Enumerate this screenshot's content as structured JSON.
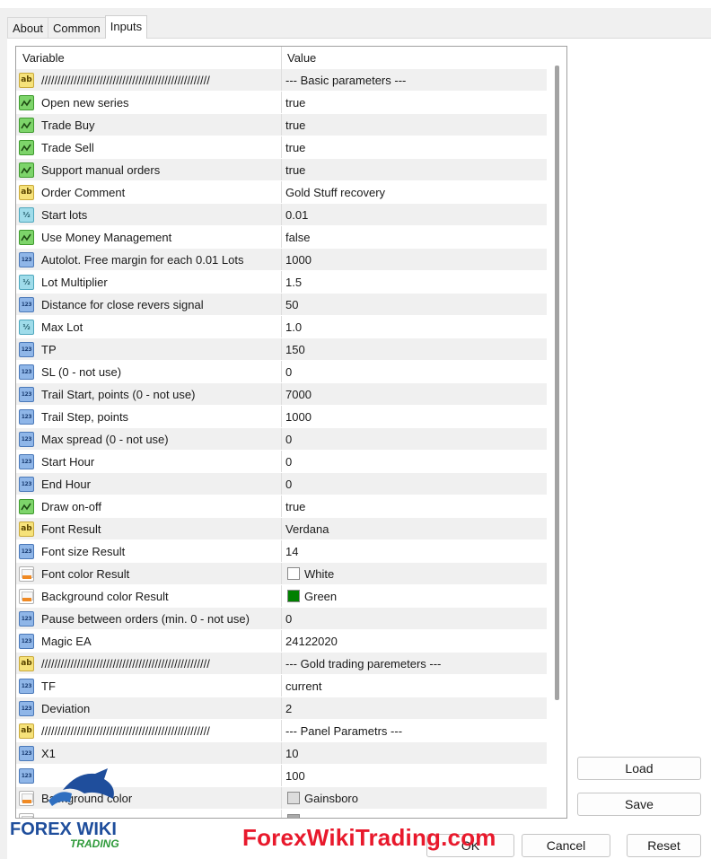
{
  "tabs": [
    {
      "label": "About",
      "active": false
    },
    {
      "label": "Common",
      "active": false
    },
    {
      "label": "Inputs",
      "active": true
    }
  ],
  "grid": {
    "headers": {
      "variable": "Variable",
      "value": "Value"
    },
    "rows": [
      {
        "type": "string",
        "icon": "string-type-icon",
        "variable": "////////////////////////////////////////////////////",
        "value": "--- Basic parameters ---"
      },
      {
        "type": "bool",
        "icon": "bool-type-icon",
        "variable": "Open new series",
        "value": "true"
      },
      {
        "type": "bool",
        "icon": "bool-type-icon",
        "variable": "Trade Buy",
        "value": "true"
      },
      {
        "type": "bool",
        "icon": "bool-type-icon",
        "variable": "Trade Sell",
        "value": "true"
      },
      {
        "type": "bool",
        "icon": "bool-type-icon",
        "variable": "Support manual orders",
        "value": "true"
      },
      {
        "type": "string",
        "icon": "string-type-icon",
        "variable": "Order Comment",
        "value": "Gold Stuff recovery"
      },
      {
        "type": "double",
        "icon": "double-type-icon",
        "variable": "Start lots",
        "value": "0.01"
      },
      {
        "type": "bool",
        "icon": "bool-type-icon",
        "variable": "Use Money Management",
        "value": "false"
      },
      {
        "type": "int",
        "icon": "int-type-icon",
        "variable": "Autolot. Free margin for each 0.01 Lots",
        "value": "1000"
      },
      {
        "type": "double",
        "icon": "double-type-icon",
        "variable": "Lot Multiplier",
        "value": "1.5"
      },
      {
        "type": "int",
        "icon": "int-type-icon",
        "variable": "Distance for close revers signal",
        "value": "50"
      },
      {
        "type": "double",
        "icon": "double-type-icon",
        "variable": "Max Lot",
        "value": "1.0"
      },
      {
        "type": "int",
        "icon": "int-type-icon",
        "variable": "TP",
        "value": "150"
      },
      {
        "type": "int",
        "icon": "int-type-icon",
        "variable": "SL (0 - not use)",
        "value": "0"
      },
      {
        "type": "int",
        "icon": "int-type-icon",
        "variable": "Trail Start, points (0 - not use)",
        "value": "7000"
      },
      {
        "type": "int",
        "icon": "int-type-icon",
        "variable": "Trail Step, points",
        "value": "1000"
      },
      {
        "type": "int",
        "icon": "int-type-icon",
        "variable": "Max spread (0 - not use)",
        "value": "0"
      },
      {
        "type": "int",
        "icon": "int-type-icon",
        "variable": "Start Hour",
        "value": "0"
      },
      {
        "type": "int",
        "icon": "int-type-icon",
        "variable": "End Hour",
        "value": "0"
      },
      {
        "type": "bool",
        "icon": "bool-type-icon",
        "variable": "Draw on-off",
        "value": "true"
      },
      {
        "type": "string",
        "icon": "string-type-icon",
        "variable": "Font Result",
        "value": "Verdana"
      },
      {
        "type": "int",
        "icon": "int-type-icon",
        "variable": "Font size Result",
        "value": "14"
      },
      {
        "type": "color",
        "icon": "color-type-icon",
        "variable": "Font color Result",
        "value": "White",
        "swatch": "#ffffff"
      },
      {
        "type": "color",
        "icon": "color-type-icon",
        "variable": "Background color Result",
        "value": "Green",
        "swatch": "#008000"
      },
      {
        "type": "int",
        "icon": "int-type-icon",
        "variable": "Pause between orders (min. 0 - not use)",
        "value": "0"
      },
      {
        "type": "int",
        "icon": "int-type-icon",
        "variable": "Magic EA",
        "value": "24122020"
      },
      {
        "type": "string",
        "icon": "string-type-icon",
        "variable": "////////////////////////////////////////////////////",
        "value": "--- Gold trading paremeters ---"
      },
      {
        "type": "int",
        "icon": "int-type-icon",
        "variable": "TF",
        "value": "current"
      },
      {
        "type": "int",
        "icon": "int-type-icon",
        "variable": "Deviation",
        "value": "2"
      },
      {
        "type": "string",
        "icon": "string-type-icon",
        "variable": "////////////////////////////////////////////////////",
        "value": "--- Panel Parametrs ---"
      },
      {
        "type": "int",
        "icon": "int-type-icon",
        "variable": "X1",
        "value": "10"
      },
      {
        "type": "int",
        "icon": "int-type-icon",
        "variable": "",
        "value": "100"
      },
      {
        "type": "color",
        "icon": "color-type-icon",
        "variable": "Background color",
        "value": "Gainsboro",
        "swatch": "#dcdcdc"
      },
      {
        "type": "color",
        "icon": "color-type-icon",
        "variable": "",
        "value": "",
        "swatch": "#a9a9a9"
      }
    ]
  },
  "buttons": {
    "load": "Load",
    "save": "Save",
    "ok": "OK",
    "cancel": "Cancel",
    "reset": "Reset"
  },
  "watermark": {
    "site": "ForexWikiTrading.com",
    "logo_text": "FOREX WIKI",
    "logo_sub": "TRADING",
    "site_color": "#e8192c",
    "logo_color": "#1f4e9c"
  },
  "colors": {
    "row_alt": "#f0f0f0",
    "int_icon": "#8fb6e8",
    "bool_icon": "#7dd46a",
    "string_icon": "#f6e27a",
    "double_icon": "#9fdcea"
  }
}
